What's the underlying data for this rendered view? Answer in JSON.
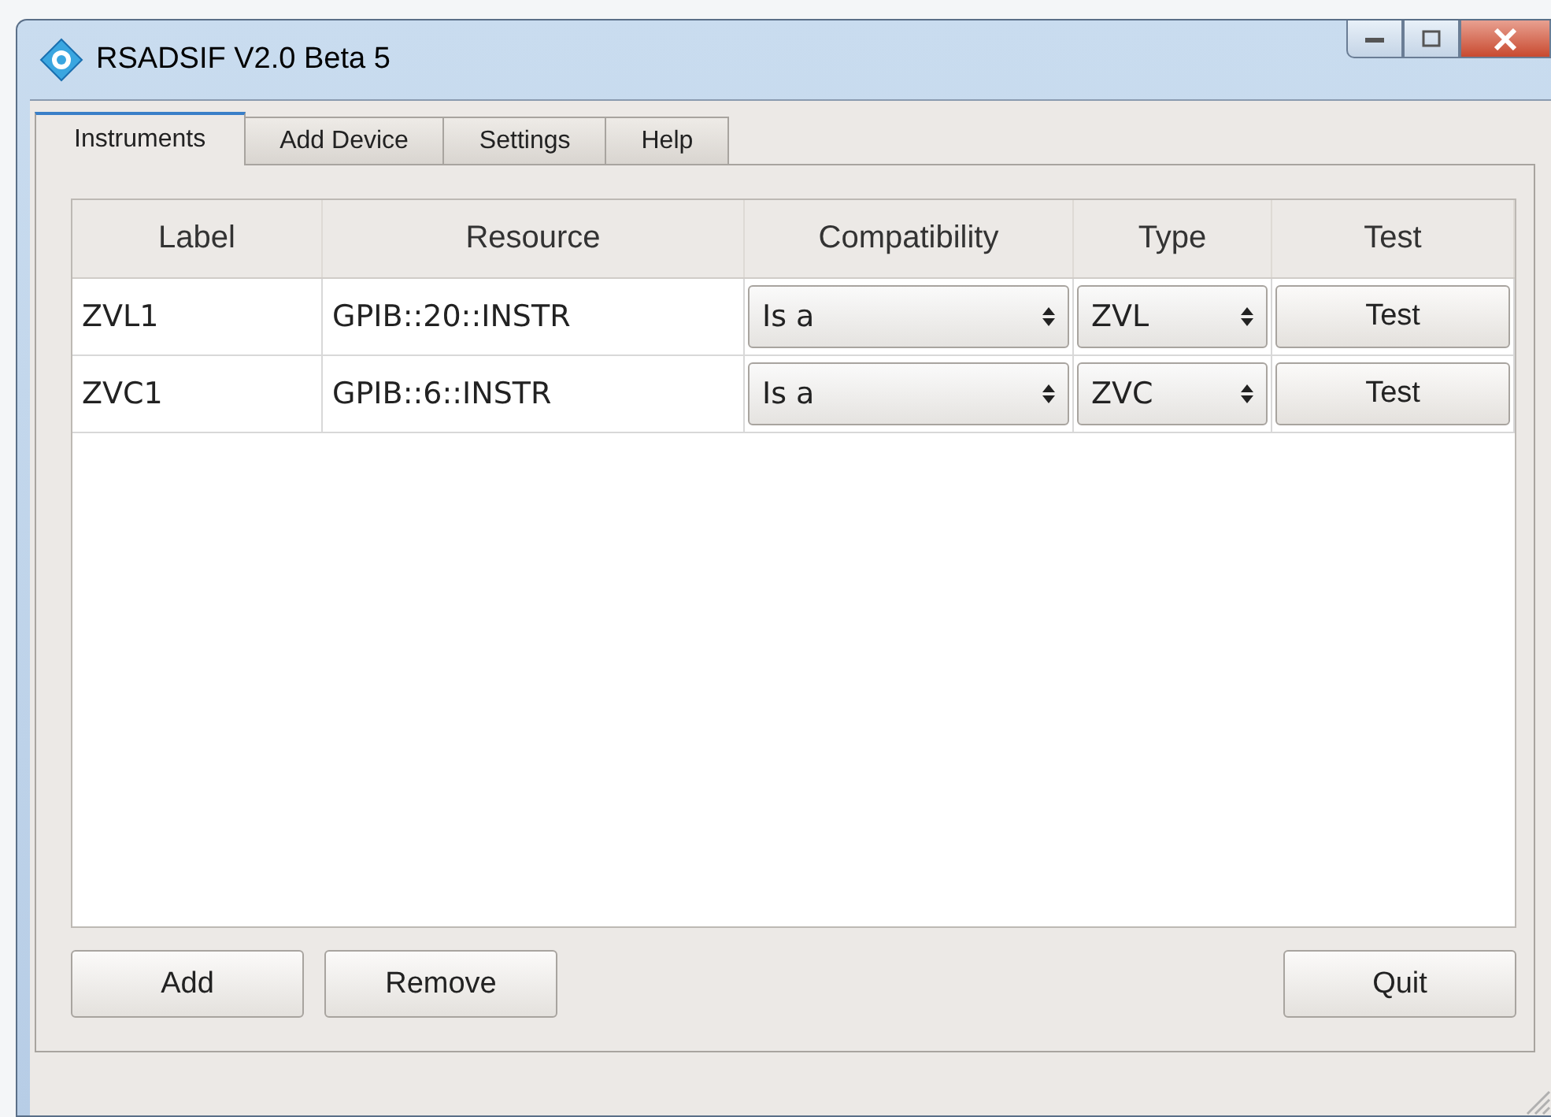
{
  "window": {
    "title": "RSADSIF V2.0 Beta 5"
  },
  "tabs": [
    {
      "label": "Instruments",
      "selected": true
    },
    {
      "label": "Add Device",
      "selected": false
    },
    {
      "label": "Settings",
      "selected": false
    },
    {
      "label": "Help",
      "selected": false
    }
  ],
  "table": {
    "columns": [
      "Label",
      "Resource",
      "Compatibility",
      "Type",
      "Test"
    ],
    "rows": [
      {
        "label": "ZVL1",
        "resource": "GPIB::20::INSTR",
        "compatibility": "Is a",
        "type": "ZVL",
        "test": "Test"
      },
      {
        "label": "ZVC1",
        "resource": "GPIB::6::INSTR",
        "compatibility": "Is a",
        "type": "ZVC",
        "test": "Test"
      }
    ]
  },
  "buttons_left": [
    "Add",
    "Remove"
  ],
  "buttons_right": [
    "Quit"
  ]
}
